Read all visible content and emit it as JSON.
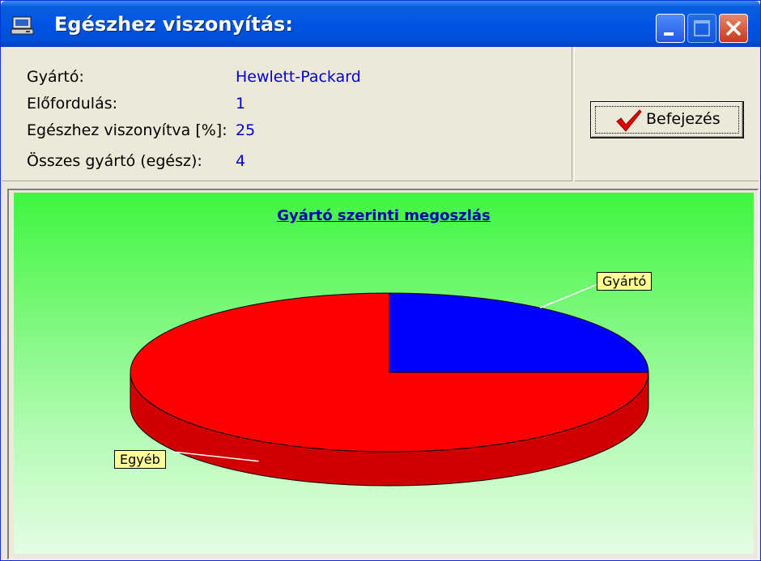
{
  "window": {
    "title": "Egészhez viszonyítás:",
    "icon": "computer-icon"
  },
  "info": {
    "manufacturer_label": "Gyártó:",
    "manufacturer_value": "Hewlett-Packard",
    "occurrence_label": "Előfordulás:",
    "occurrence_value": "1",
    "percent_label": "Egészhez viszonyítva [%]:",
    "percent_value": "25",
    "total_label": "Összes gyártó (egész):",
    "total_value": "4"
  },
  "done_button": {
    "label": "Befejezés",
    "icon": "red-checkmark-icon"
  },
  "colors": {
    "titlebar": "#0054e3",
    "info_value": "#0000cc",
    "chart_title": "#0000b0",
    "slice_manufacturer": "#0000ff",
    "slice_other": "#ff0000",
    "label_background": "#ffff99"
  },
  "chart_data": {
    "type": "pie",
    "title": "Gyártó szerinti megoszlás",
    "style": "3d",
    "categories": [
      "Gyártó",
      "Egyéb"
    ],
    "values": [
      25,
      75
    ],
    "colors": [
      "#0000ff",
      "#ff0000"
    ],
    "legend": "none"
  }
}
